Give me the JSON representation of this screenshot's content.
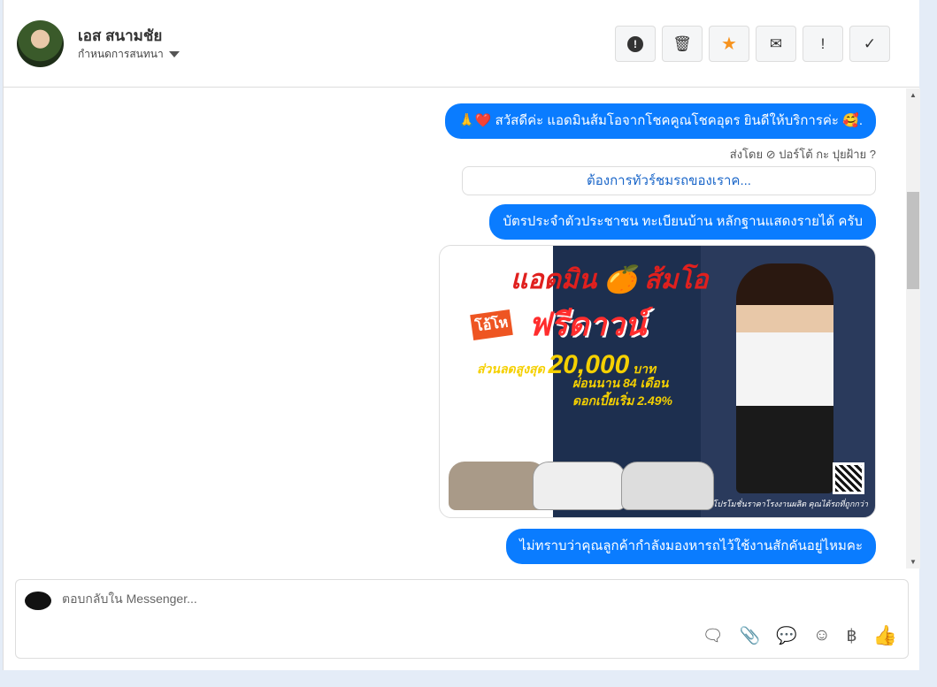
{
  "header": {
    "name": "เอส สนามชัย",
    "subtitle": "กำหนดการสนทนา",
    "actions": [
      {
        "icon": "alert-circle-icon",
        "glyph": "⬤"
      },
      {
        "icon": "trash-icon",
        "glyph": "🗑"
      },
      {
        "icon": "star-icon",
        "glyph": "★"
      },
      {
        "icon": "envelope-icon",
        "glyph": "✉"
      },
      {
        "icon": "exclamation-icon",
        "glyph": "!"
      },
      {
        "icon": "check-icon",
        "glyph": "✓"
      }
    ]
  },
  "messages": {
    "greeting": "🙏❤️ สวัสดีค่ะ แอดมินส้มโอจากโชคคูณโชคอุดร ยินดีให้บริการค่ะ 🥰.",
    "sent_by": "ส่งโดย ⊘ ปอร์โต้ กะ ปุยฝ้าย ?",
    "quick_reply": "ต้องการทัวร์ชมรถของเราค...",
    "docs": "บัตรประจำตัวประชาชน ทะเบียนบ้าน หลักฐานแสดงรายได้ ครับ",
    "ask": "ไม่ทราบว่าคุณลูกค้ากำลังมองหารถไว้ใช้งานสักคันอยู่ไหมคะ"
  },
  "ad": {
    "title": "แอดมิน 🍊 ส้มโอ",
    "wow": "โอ้โห",
    "free_down": "ฟรีดาวน์",
    "discount_label": "ส่วนลดสูงสุด",
    "discount_value": "20,000",
    "discount_unit": "บาท",
    "installment": "ผ่อนนาน 84 เดือน",
    "interest": "ดอกเบี้ยเริ่ม 2.49%",
    "footer": "โปรโมชั่นราคาโรงงานผลิต คุณได้รถที่ถูกกว่า"
  },
  "composer": {
    "placeholder": "ตอบกลับใน Messenger...",
    "baht": "฿"
  },
  "colors": {
    "accent": "#0a7cff",
    "star": "#f7931e"
  }
}
